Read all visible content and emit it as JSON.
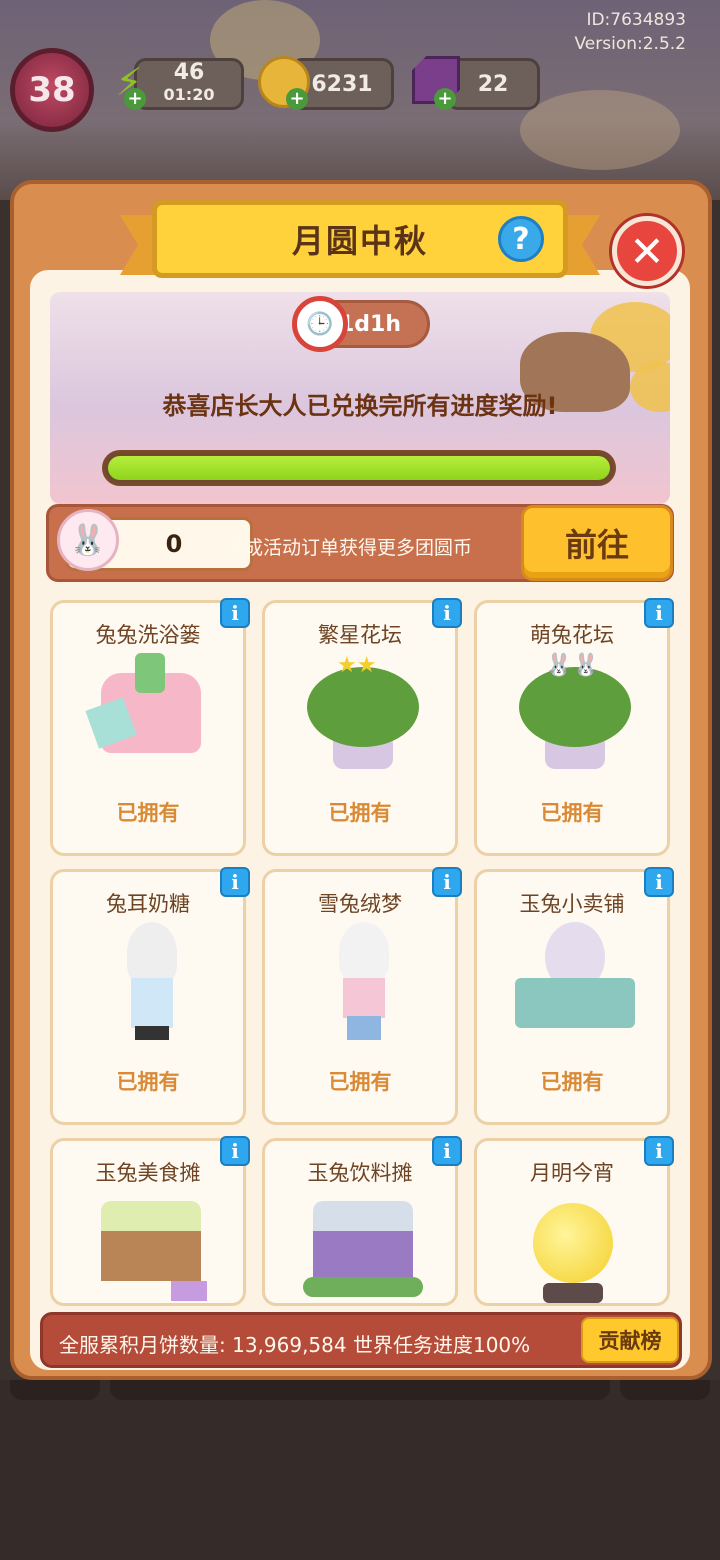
{
  "meta": {
    "id_text": "ID:7634893",
    "version_text": "Version:2.5.2"
  },
  "hud": {
    "level": "38",
    "energy": "46",
    "energy_timer": "01:20",
    "coins": "6231",
    "gems": "22"
  },
  "event": {
    "title": "月圆中秋",
    "timer": "1d1h",
    "message": "恭喜店长大人已兑换完所有进度奖励!",
    "progress_fraction": 1.0
  },
  "currency": {
    "amount": "0",
    "hint": "完成活动订单获得更多团圆币",
    "go_label": "前往"
  },
  "rewards": [
    {
      "name": "兔兔洗浴篓",
      "status": "已拥有",
      "art": "bath-basket"
    },
    {
      "name": "繁星花坛",
      "status": "已拥有",
      "art": "star-flowerbed"
    },
    {
      "name": "萌兔花坛",
      "status": "已拥有",
      "art": "bunny-flowerbed"
    },
    {
      "name": "兔耳奶糖",
      "status": "已拥有",
      "art": "bunny-girl-outfit"
    },
    {
      "name": "雪兔绒梦",
      "status": "已拥有",
      "art": "bunny-boy-outfit"
    },
    {
      "name": "玉兔小卖铺",
      "status": "已拥有",
      "art": "bunny-shop"
    },
    {
      "name": "玉兔美食摊",
      "status": "",
      "art": "food-stall"
    },
    {
      "name": "玉兔饮料摊",
      "status": "",
      "art": "drink-stall"
    },
    {
      "name": "月明今宵",
      "status": "",
      "art": "full-moon"
    }
  ],
  "footer": {
    "stat_text": "全服累积月饼数量: 13,969,584  世界任务进度100%",
    "rank_label": "贡献榜"
  },
  "icons": {
    "info": "i",
    "help": "?",
    "close": "✕"
  }
}
